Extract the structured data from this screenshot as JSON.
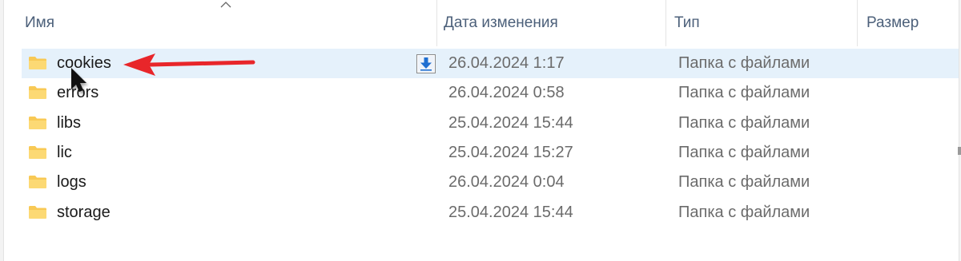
{
  "columns": {
    "name": "Имя",
    "date": "Дата изменения",
    "type": "Тип",
    "size": "Размер"
  },
  "files": [
    {
      "name": "cookies",
      "date": "26.04.2024 1:17",
      "type": "Папка с файлами",
      "selected": true
    },
    {
      "name": "errors",
      "date": "26.04.2024 0:58",
      "type": "Папка с файлами",
      "selected": false
    },
    {
      "name": "libs",
      "date": "25.04.2024 15:44",
      "type": "Папка с файлами",
      "selected": false
    },
    {
      "name": "lic",
      "date": "25.04.2024 15:27",
      "type": "Папка с файлами",
      "selected": false
    },
    {
      "name": "logs",
      "date": "26.04.2024 0:04",
      "type": "Папка с файлами",
      "selected": false
    },
    {
      "name": "storage",
      "date": "25.04.2024 15:44",
      "type": "Папка с файлами",
      "selected": false
    }
  ],
  "colors": {
    "selection": "#e5f1fb",
    "folder": "#f8c955",
    "annotation_arrow": "#e8262a",
    "download_icon": "#1f6fd1"
  },
  "icons": {
    "folder": "folder-icon",
    "sort": "sort-ascending-icon",
    "download": "download-icon",
    "cursor": "mouse-cursor-icon",
    "annotation": "red-arrow-annotation"
  }
}
